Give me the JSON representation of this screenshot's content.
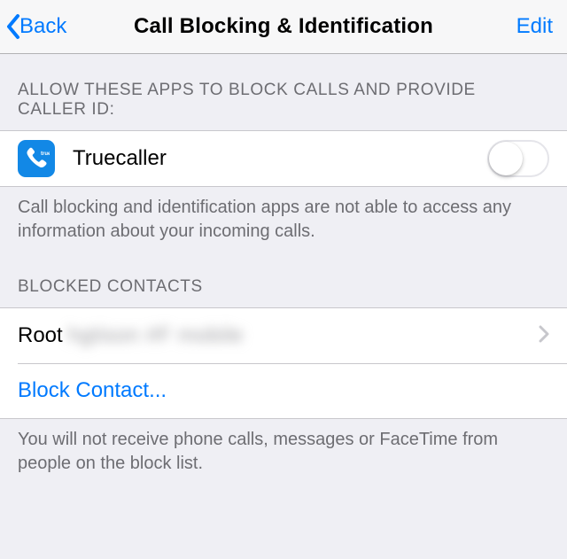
{
  "nav": {
    "back_label": "Back",
    "title": "Call Blocking & Identification",
    "edit_label": "Edit"
  },
  "sections": {
    "apps": {
      "header": "Allow these apps to block calls and provide caller ID:",
      "footer": "Call blocking and identification apps are not able to access any information about your incoming calls.",
      "items": [
        {
          "name": "Truecaller",
          "enabled": false,
          "icon": "phone-icon"
        }
      ]
    },
    "blocked": {
      "header": "Blocked Contacts",
      "footer": "You will not receive phone calls, messages or FaceTime from people on the block list.",
      "contacts": [
        {
          "display_prefix": "Root",
          "obscured_remainder": "hgtison  #F  mobile"
        }
      ],
      "add_label": "Block Contact..."
    }
  },
  "colors": {
    "tint": "#007aff",
    "app_icon_bg": "#1288e6"
  }
}
